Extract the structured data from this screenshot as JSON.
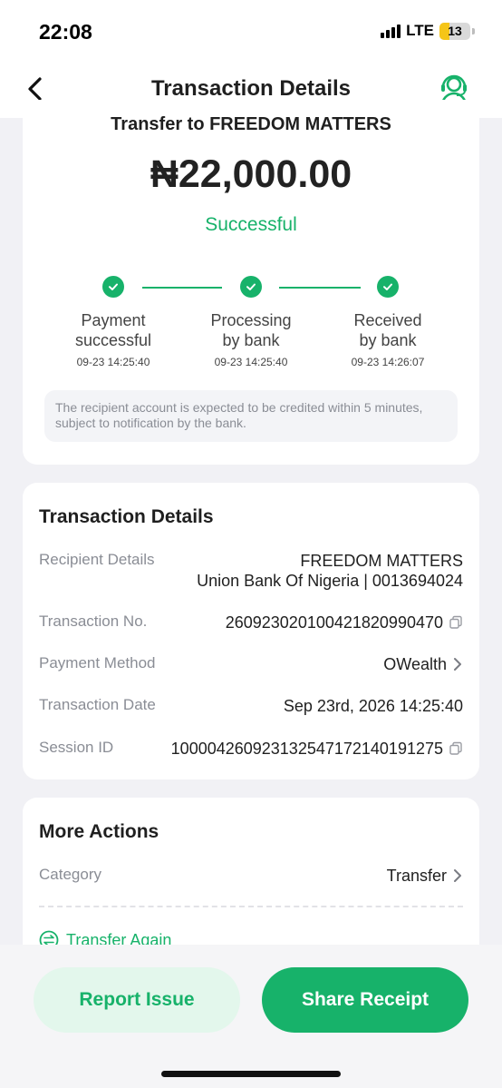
{
  "status_bar": {
    "time": "22:08",
    "network": "LTE",
    "battery": "13",
    "battery_level": 0.13
  },
  "header": {
    "title": "Transaction Details"
  },
  "summary": {
    "transfer_to": "Transfer to FREEDOM MATTERS",
    "amount": "₦22,000.00",
    "status": "Successful",
    "steps": [
      {
        "line1": "Payment",
        "line2": "successful",
        "time": "09-23 14:25:40"
      },
      {
        "line1": "Processing",
        "line2": "by bank",
        "time": "09-23 14:25:40"
      },
      {
        "line1": "Received",
        "line2": "by bank",
        "time": "09-23 14:26:07"
      }
    ],
    "note": "The recipient account is expected to be credited within 5 minutes, subject to notification by the bank."
  },
  "details": {
    "title": "Transaction Details",
    "recipient_label": "Recipient Details",
    "recipient_name": "FREEDOM MATTERS",
    "recipient_bank": "Union Bank Of Nigeria | 0013694024",
    "txn_no_label": "Transaction No.",
    "txn_no": "260923020100421820990470",
    "method_label": "Payment Method",
    "method": "OWealth",
    "date_label": "Transaction Date",
    "date": "Sep 23rd, 2026 14:25:40",
    "session_label": "Session ID",
    "session": "100004260923132547172140191275"
  },
  "actions": {
    "title": "More Actions",
    "category_label": "Category",
    "category": "Transfer",
    "transfer_again": "Transfer Again"
  },
  "buttons": {
    "report": "Report Issue",
    "share": "Share Receipt"
  },
  "colors": {
    "accent": "#17b26a",
    "accent_light": "#e3f7ec",
    "muted": "#8a8d95"
  },
  "icons": [
    "back-arrow-icon",
    "headset-support-icon",
    "check-icon",
    "copy-icon",
    "chevron-right-icon",
    "transfer-icon"
  ]
}
